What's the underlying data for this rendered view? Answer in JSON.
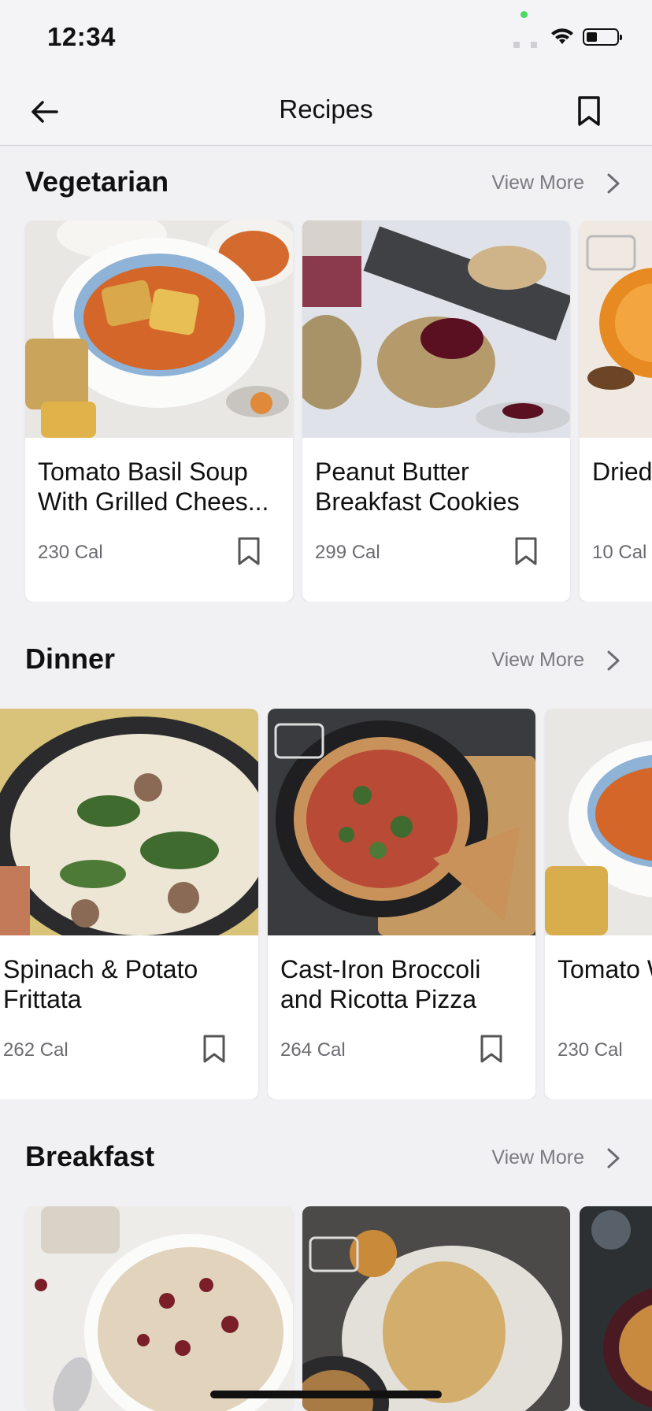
{
  "status_bar": {
    "time": "12:34"
  },
  "header": {
    "title": "Recipes"
  },
  "view_more_label": "View More",
  "sections": [
    {
      "title": "Vegetarian",
      "cards": [
        {
          "title": "Tomato Basil Soup With Grilled Chees...",
          "calories": "230 Cal"
        },
        {
          "title": "Peanut Butter Breakfast Cookies",
          "calories": "299 Cal"
        },
        {
          "title": "Dried Mock",
          "calories": "10 Cal"
        }
      ]
    },
    {
      "title": "Dinner",
      "cards": [
        {
          "title": "Spinach & Potato Frittata",
          "calories": "262 Cal"
        },
        {
          "title": "Cast-Iron Broccoli and Ricotta Pizza",
          "calories": "264 Cal"
        },
        {
          "title": "Tomato With Gri",
          "calories": "230 Cal"
        }
      ]
    },
    {
      "title": "Breakfast",
      "cards": [
        {
          "title": "",
          "calories": ""
        },
        {
          "title": "",
          "calories": ""
        },
        {
          "title": "",
          "calories": ""
        }
      ]
    }
  ]
}
